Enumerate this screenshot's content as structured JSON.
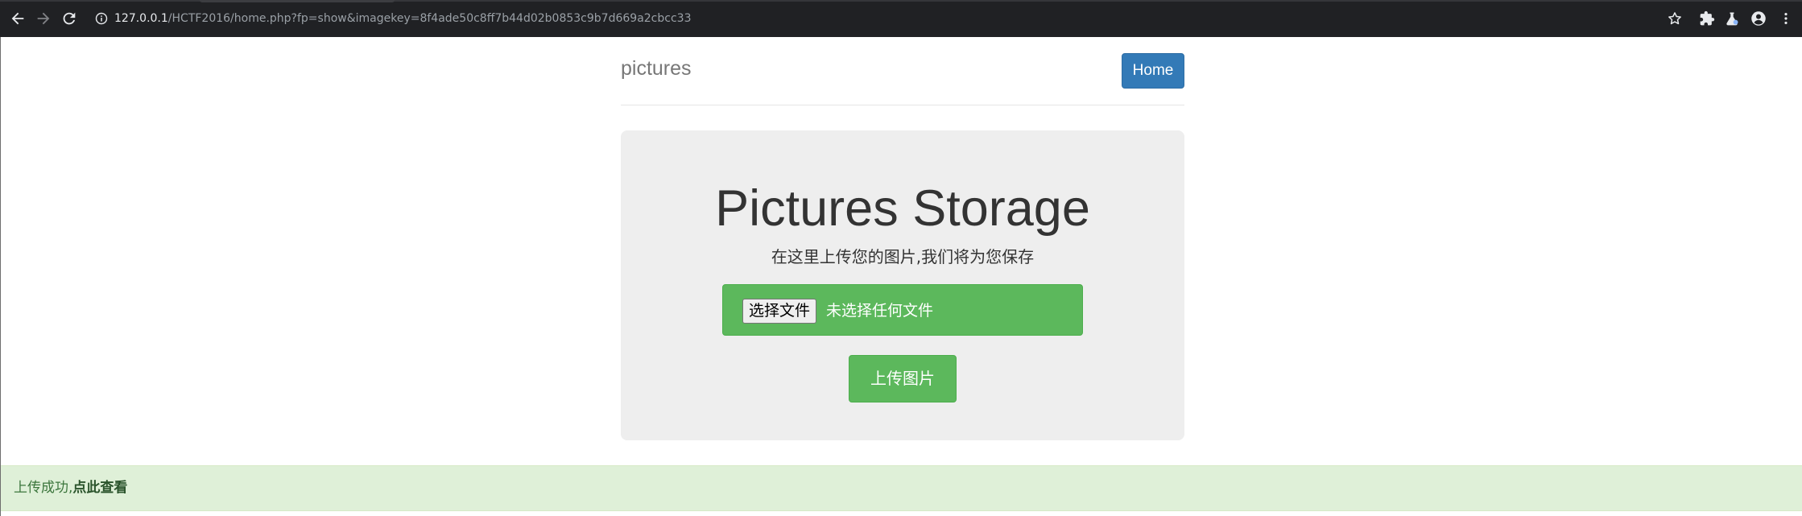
{
  "browser": {
    "url_host": "127.0.0.1",
    "url_path": "/HCTF2016/home.php?fp=show&imagekey=8f4ade50c8ff7b44d02b0853c9b7d669a2cbcc33",
    "icons": [
      "back-icon",
      "forward-icon",
      "reload-icon",
      "info-icon",
      "star-icon",
      "extensions-icon",
      "lab-icon",
      "profile-icon",
      "menu-icon"
    ]
  },
  "header": {
    "brand": "pictures",
    "home_label": "Home"
  },
  "jumbotron": {
    "title": "Pictures Storage",
    "subtitle": "在这里上传您的图片,我们将为您保存",
    "choose_file_label": "选择文件",
    "file_status": "未选择任何文件",
    "upload_label": "上传图片"
  },
  "alert": {
    "message": "上传成功,",
    "link_text": "点此查看"
  },
  "colors": {
    "primary": "#337ab7",
    "success": "#5cb85c",
    "jumbotron_bg": "#eeeeee",
    "alert_bg": "#dff0d8",
    "alert_text": "#3c763d",
    "chrome_bg": "#202124"
  }
}
